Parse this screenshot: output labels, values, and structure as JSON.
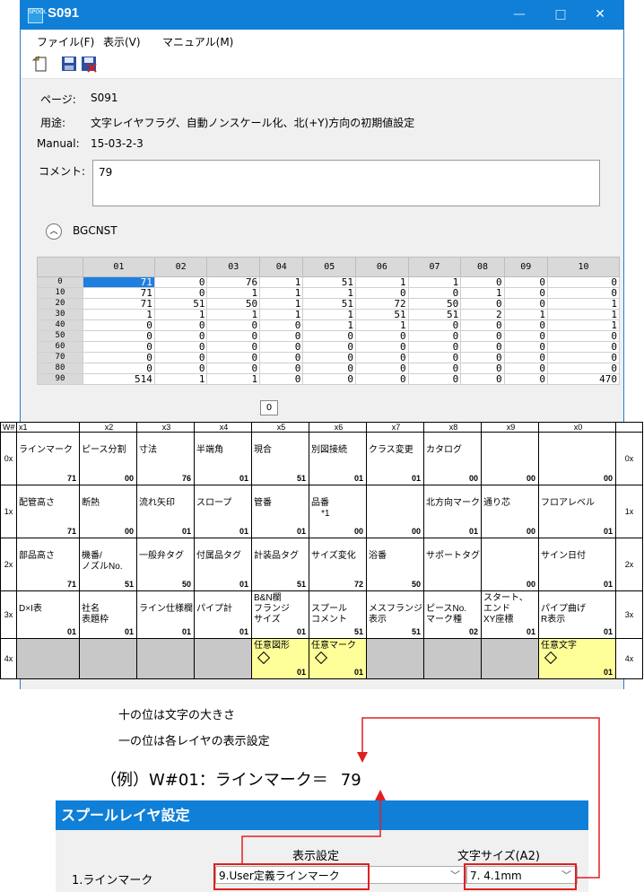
{
  "window": {
    "title": "S091",
    "app_icon_text": "SPOOL",
    "controls": {
      "minimize": "—",
      "maximize": "□",
      "close": "✕"
    }
  },
  "menu": [
    "ファイル(F)",
    "表示(V)",
    "マニュアル(M)"
  ],
  "toolbar_icons": [
    "export-icon",
    "save-icon",
    "save-as-icon"
  ],
  "info": {
    "page_label": "ページ:",
    "page_value": "S091",
    "purpose_label": "用途:",
    "purpose_value": "文字レイヤフラグ、自動ノンスケール化、北(+Y)方向の初期値設定",
    "manual_label": "Manual:",
    "manual_value": "15-03-2-3",
    "comment_label": "コメント:",
    "comment_value": "79"
  },
  "section": {
    "name": "BGCNST"
  },
  "grid": {
    "columns": [
      "01",
      "02",
      "03",
      "04",
      "05",
      "06",
      "07",
      "08",
      "09",
      "10"
    ],
    "rows": [
      {
        "label": "0",
        "cells": [
          "71",
          "0",
          "76",
          "1",
          "51",
          "1",
          "1",
          "0",
          "0",
          "0"
        ]
      },
      {
        "label": "10",
        "cells": [
          "71",
          "0",
          "1",
          "1",
          "1",
          "0",
          "0",
          "1",
          "0",
          "0"
        ]
      },
      {
        "label": "20",
        "cells": [
          "71",
          "51",
          "50",
          "1",
          "51",
          "72",
          "50",
          "0",
          "0",
          "1"
        ]
      },
      {
        "label": "30",
        "cells": [
          "1",
          "1",
          "1",
          "1",
          "1",
          "51",
          "51",
          "2",
          "1",
          "1"
        ]
      },
      {
        "label": "40",
        "cells": [
          "0",
          "0",
          "0",
          "0",
          "1",
          "1",
          "0",
          "0",
          "0",
          "1"
        ]
      },
      {
        "label": "50",
        "cells": [
          "0",
          "0",
          "0",
          "0",
          "0",
          "0",
          "0",
          "0",
          "0",
          "0"
        ]
      },
      {
        "label": "60",
        "cells": [
          "0",
          "0",
          "0",
          "0",
          "0",
          "0",
          "0",
          "0",
          "0",
          "0"
        ]
      },
      {
        "label": "70",
        "cells": [
          "0",
          "0",
          "0",
          "0",
          "0",
          "0",
          "0",
          "0",
          "0",
          "0"
        ]
      },
      {
        "label": "80",
        "cells": [
          "0",
          "0",
          "0",
          "0",
          "0",
          "0",
          "0",
          "0",
          "0",
          "0"
        ]
      },
      {
        "label": "90",
        "cells": [
          "514",
          "1",
          "1",
          "0",
          "0",
          "0",
          "0",
          "0",
          "0",
          "470"
        ]
      }
    ],
    "tooltip": "0"
  },
  "wtable": {
    "header": [
      "W#",
      "x1",
      "x2",
      "x3",
      "x4",
      "x5",
      "x6",
      "x7",
      "x8",
      "x9",
      "x0",
      ""
    ],
    "rows": [
      {
        "label": "0x",
        "cells": [
          {
            "name": "ラインマーク",
            "value": "71"
          },
          {
            "name": "ピース分割",
            "value": "00"
          },
          {
            "name": "寸法",
            "value": "76"
          },
          {
            "name": "半端角",
            "value": "01"
          },
          {
            "name": "現合",
            "value": "51"
          },
          {
            "name": "別図接続",
            "value": "01"
          },
          {
            "name": "クラス変更",
            "value": "01"
          },
          {
            "name": "カタログ",
            "value": "00"
          },
          {
            "name": "",
            "value": "00"
          },
          {
            "name": "",
            "value": "00"
          }
        ]
      },
      {
        "label": "1x",
        "cells": [
          {
            "name": "配管高さ",
            "value": "71"
          },
          {
            "name": "断熱",
            "value": "00"
          },
          {
            "name": "流れ矢印",
            "value": "01"
          },
          {
            "name": "スロープ",
            "value": "01"
          },
          {
            "name": "管番",
            "value": "01"
          },
          {
            "name": "品番\n    *1",
            "value": "00"
          },
          {
            "name": "",
            "value": "00"
          },
          {
            "name": "北方向マーク",
            "value": "01"
          },
          {
            "name": "通り芯",
            "value": "00"
          },
          {
            "name": "フロアレベル",
            "value": "01"
          }
        ]
      },
      {
        "label": "2x",
        "cells": [
          {
            "name": "部品高さ",
            "value": "71"
          },
          {
            "name": "機番/\nノズルNo.",
            "value": "51"
          },
          {
            "name": "一般弁タグ",
            "value": "50"
          },
          {
            "name": "付属品タグ",
            "value": "01"
          },
          {
            "name": "計装品タグ",
            "value": "51"
          },
          {
            "name": "サイズ変化",
            "value": "72"
          },
          {
            "name": "浴番",
            "value": "50"
          },
          {
            "name": "サポートタグ",
            "value": ""
          },
          {
            "name": "",
            "value": "00"
          },
          {
            "name": "サイン日付",
            "value": "01"
          }
        ]
      },
      {
        "label": "3x",
        "cells": [
          {
            "name": "D×I表",
            "value": "01"
          },
          {
            "name": "社名\n表題枠",
            "value": "01"
          },
          {
            "name": "ライン仕様欄",
            "value": "01"
          },
          {
            "name": "パイプ計",
            "value": "01"
          },
          {
            "name": "B&N欄\nフランジ\nサイズ",
            "value": "01"
          },
          {
            "name": "スプール\nコメント",
            "value": "51"
          },
          {
            "name": "メスフランジ\n表示",
            "value": "51"
          },
          {
            "name": "ピースNo.\nマーク種",
            "value": "02"
          },
          {
            "name": "スタート、\nエンド\nXY座標",
            "value": "01"
          },
          {
            "name": "パイプ曲げ\nR表示",
            "value": "01"
          }
        ]
      },
      {
        "label": "4x",
        "cells": [
          {
            "name": "",
            "value": "",
            "style": "gray"
          },
          {
            "name": "",
            "value": "",
            "style": "gray"
          },
          {
            "name": "",
            "value": "",
            "style": "gray"
          },
          {
            "name": "",
            "value": "",
            "style": "gray"
          },
          {
            "name": "任意図形",
            "value": "01",
            "style": "yel"
          },
          {
            "name": "任意マーク",
            "value": "01",
            "style": "yel"
          },
          {
            "name": "",
            "value": "",
            "style": "gray"
          },
          {
            "name": "",
            "value": "",
            "style": "gray"
          },
          {
            "name": "",
            "value": "",
            "style": "gray"
          },
          {
            "name": "任意文字",
            "value": "01",
            "style": "yel"
          }
        ]
      }
    ]
  },
  "notes": {
    "line1": "十の位は文字の大きさ",
    "line2": "一の位は各レイヤの表示設定",
    "example_text": "（例）W#01：ラインマーク＝",
    "example_value": "79"
  },
  "spool_panel": {
    "title": "スプールレイヤ設定",
    "col_display": "表示設定",
    "col_size": "文字サイズ(A2)",
    "row_label": "1.ラインマーク",
    "display_value": "9.User定義ラインマーク",
    "size_value": "7. 4.1mm"
  },
  "colors": {
    "accent": "#0f7fd7",
    "selection": "#1e7fe0",
    "highlight": "#ffff99",
    "annotation": "#e02020"
  }
}
